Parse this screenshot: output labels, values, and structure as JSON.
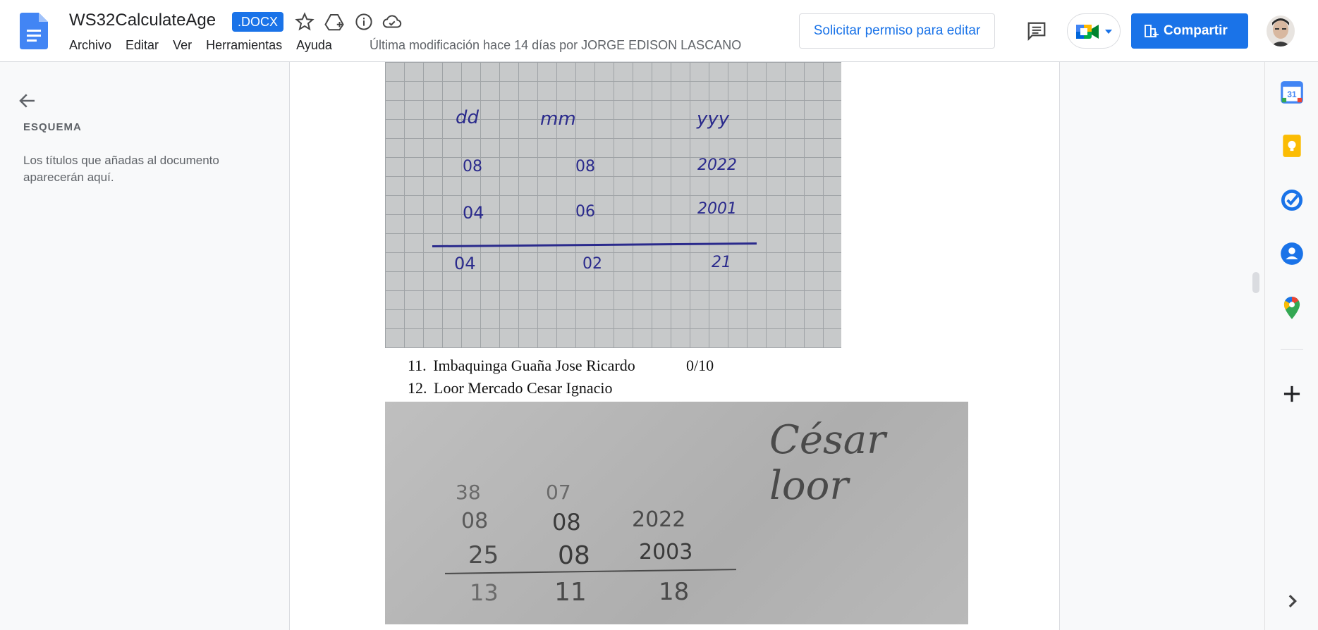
{
  "header": {
    "doc_title": "WS32CalculateAge",
    "file_badge": ".DOCX",
    "menu": [
      "Archivo",
      "Editar",
      "Ver",
      "Herramientas",
      "Ayuda"
    ],
    "last_modified": "Última modificación hace 14 días por JORGE EDISON LASCANO",
    "request_edit": "Solicitar permiso para editar",
    "share": "Compartir",
    "accent": "#1a73e8"
  },
  "outline": {
    "heading": "ESQUEMA",
    "hint": "Los títulos que añadas al documento aparecerán aquí."
  },
  "document": {
    "image1": {
      "headers": [
        "dd",
        "mm",
        "yyy"
      ],
      "row1": [
        "08",
        "08",
        "2022"
      ],
      "row2": [
        "04",
        "06",
        "2001"
      ],
      "result": [
        "04",
        "02",
        "21"
      ]
    },
    "list": [
      {
        "num": "11.",
        "name": "Imbaquinga Guaña Jose Ricardo",
        "score": "0/10"
      },
      {
        "num": "12.",
        "name": "Loor Mercado Cesar Ignacio",
        "score": ""
      }
    ],
    "image2": {
      "signature": "César loor",
      "borrow": [
        "38",
        "07"
      ],
      "row1": [
        "08",
        "08",
        "2022"
      ],
      "row2": [
        "25",
        "08",
        "2003"
      ],
      "result": [
        "13",
        "11",
        "18"
      ]
    }
  },
  "right_rail": {
    "icons": [
      "calendar-icon",
      "keep-icon",
      "tasks-icon",
      "contacts-icon",
      "maps-icon",
      "add-icon",
      "expand-icon"
    ],
    "calendar_day": "31"
  }
}
